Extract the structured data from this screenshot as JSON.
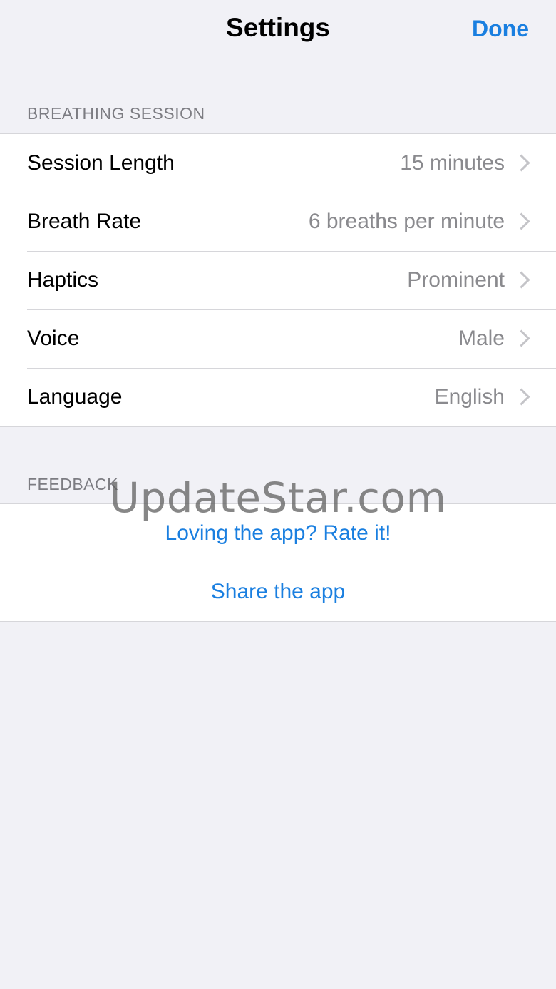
{
  "navbar": {
    "title": "Settings",
    "done_label": "Done"
  },
  "breathing_session": {
    "header": "BREATHING SESSION",
    "rows": [
      {
        "label": "Session Length",
        "value": "15 minutes"
      },
      {
        "label": "Breath Rate",
        "value": "6 breaths per minute"
      },
      {
        "label": "Haptics",
        "value": "Prominent"
      },
      {
        "label": "Voice",
        "value": "Male"
      },
      {
        "label": "Language",
        "value": "English"
      }
    ]
  },
  "feedback": {
    "header": "FEEDBACK",
    "actions": [
      {
        "label": "Loving the app? Rate it!"
      },
      {
        "label": "Share the app"
      }
    ]
  },
  "watermark": "UpdateStar.com",
  "colors": {
    "accent": "#1a7fe0",
    "background": "#f1f1f6",
    "secondary_text": "#8a8a8e"
  }
}
